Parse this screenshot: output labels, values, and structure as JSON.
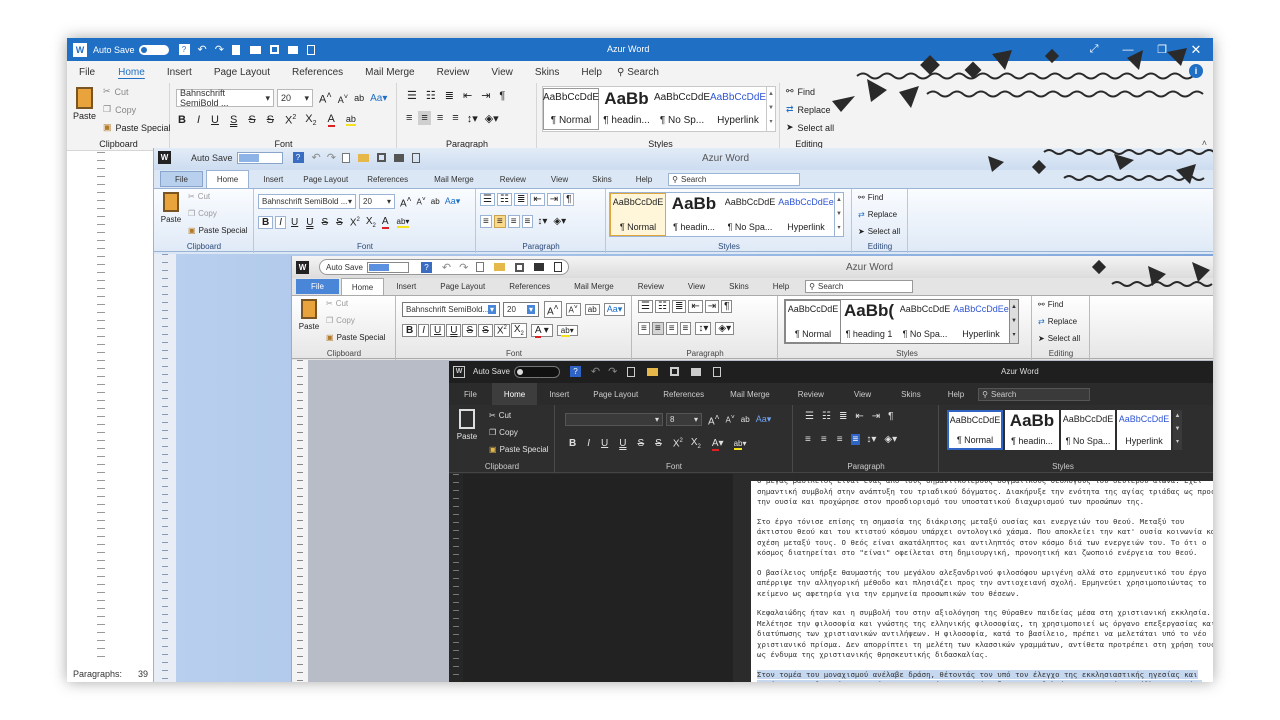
{
  "tabs": [
    "File",
    "Home",
    "Insert",
    "Page Layout",
    "References",
    "Mail Merge",
    "Review",
    "View",
    "Skins",
    "Help"
  ],
  "w1": {
    "autosave": "Auto Save",
    "title": "Azur Word",
    "search": "Search",
    "font_name": "Bahnschrift SemiBold ...",
    "font_size": "20",
    "clip": {
      "paste": "Paste",
      "cut": "Cut",
      "copy": "Copy",
      "paste_special": "Paste Special"
    },
    "groups": {
      "clipboard": "Clipboard",
      "font": "Font",
      "paragraph": "Paragraph",
      "styles": "Styles",
      "editing": "Editing"
    },
    "styles": [
      {
        "sample": "AaBbCcDdE",
        "name": "¶ Normal"
      },
      {
        "sample": "AaBb",
        "name": "¶ headin..."
      },
      {
        "sample": "AaBbCcDdE",
        "name": "¶ No Sp..."
      },
      {
        "sample": "AaBbCcDdE",
        "name": "Hyperlink"
      }
    ],
    "editing": {
      "find": "Find",
      "replace": "Replace",
      "select_all": "Select all"
    },
    "status_label": "Paragraphs:",
    "status_value": "39",
    "status_extra": "W"
  },
  "w2": {
    "autosave": "Auto Save",
    "title": "Azur Word",
    "search": "Search",
    "font_name": "Bahnschrift SemiBold ...",
    "font_size": "20",
    "clip": {
      "paste": "Paste",
      "cut": "Cut",
      "copy": "Copy",
      "paste_special": "Paste Special"
    },
    "groups": {
      "clipboard": "Clipboard",
      "font": "Font",
      "paragraph": "Paragraph",
      "styles": "Styles",
      "editing": "Editing"
    },
    "styles": [
      {
        "sample": "AaBbCcDdE",
        "name": "¶ Normal"
      },
      {
        "sample": "AaBb",
        "name": "¶ headin..."
      },
      {
        "sample": "AaBbCcDdE",
        "name": "¶ No Spa..."
      },
      {
        "sample": "AaBbCcDdEe",
        "name": "Hyperlink"
      }
    ],
    "editing": {
      "find": "Find",
      "replace": "Replace",
      "select_all": "Select all"
    }
  },
  "w3": {
    "autosave": "Auto Save",
    "title": "Azur Word",
    "search": "Search",
    "font_name": "Bahnschrift SemiBold...",
    "font_size": "20",
    "clip": {
      "paste": "Paste",
      "cut": "Cut",
      "copy": "Copy",
      "paste_special": "Paste Special"
    },
    "groups": {
      "clipboard": "Clipboard",
      "font": "Font",
      "paragraph": "Paragraph",
      "styles": "Styles",
      "editing": "Editing"
    },
    "styles": [
      {
        "sample": "AaBbCcDdE",
        "name": "¶ Normal"
      },
      {
        "sample": "AaBb(",
        "name": "¶ heading 1"
      },
      {
        "sample": "AaBbCcDdE",
        "name": "¶ No Spa..."
      },
      {
        "sample": "AaBbCcDdEe",
        "name": "Hyperlink"
      }
    ],
    "editing": {
      "find": "Find",
      "replace": "Replace",
      "select_all": "Select all"
    }
  },
  "w4": {
    "autosave": "Auto Save",
    "title": "Azur Word",
    "search": "Search",
    "font_name": "",
    "font_size": "8",
    "clip": {
      "paste": "Paste",
      "cut": "Cut",
      "copy": "Copy",
      "paste_special": "Paste Special"
    },
    "groups": {
      "clipboard": "Clipboard",
      "font": "Font",
      "paragraph": "Paragraph",
      "styles": "Styles"
    },
    "styles": [
      {
        "sample": "AaBbCcDdE",
        "name": "¶ Normal"
      },
      {
        "sample": "AaBb",
        "name": "¶ headin..."
      },
      {
        "sample": "AaBbCcDdE",
        "name": "¶ No Spa..."
      },
      {
        "sample": "AaBbCcDdE",
        "name": "Hyperlink"
      }
    ]
  },
  "doc": {
    "paragraphs": [
      "Ο μέγας βασίλειος είναι ένας από τους σημαντικότερους δογματικούς θεολόγους του δεύτερου αιώνα. Έχει σημαντική συμβολή στην ανάπτυξη του τριαδικού δόγματος. Διακήρυξε την ενότητα της αγίας τριάδας ως προς την ουσία και προχώρησε στον προσδιορισμό του υποστατικού διαχωρισμού των προσώπων της.",
      "Στο έργο τόνισε επίσης τη σημασία της διάκρισης μεταξύ ουσίας και ενεργειών του θεού. Μεταξύ του άκτιστου θεού και του κτιστού κόσμου υπάρχει οντολογικό χάσμα. Που αποκλείει την κατ' ουσία κοινωνία και σχέση μεταξύ τους. Ο θεός είναι ακατάληπτος και αντιληπτός στον κόσμο διά των ενεργειών του. Το ότι ο κόσμος διατηρείται στο \"είναι\" οφείλεται στη δημιουργική, προνοητική και ζωοποιό ενέργεια του θεού.",
      "Ο βασίλειος υπήρξε θαυμαστής του μεγάλου αλεξανδρινού φιλοσόφου ωριγένη αλλά στο ερμηνευτικό του έργο απέρριψε την αλληγορική μέθοδο και πλησιάζει προς την αντιοχειανή σχολή. Ερμηνεύει χρησιμοποιώντας το κείμενο ως αφετηρία για την ερμηνεία προσωπικών του θέσεων.",
      "Κεφαλαιώδης ήταν και η συμβολή του στην αξιολόγηση της θύραθεν παιδείας μέσα στη χριστιανική εκκλησία. Μελέτησε την φιλοσοφία και γνώστης της ελληνικής φιλοσοφίας, τη χρησιμοποιεί ως όργανο επεξεργασίας και διατύπωσης των χριστιανικών αντιλήψεων. Η φιλοσοφία, κατά το βασίλειο, πρέπει να μελετάται υπό το νέο χριστιανικό πρίσμα. Δεν απορρίπτει τη μελέτη των κλασσικών γραμμάτων, αντίθετα προτρέπει στη χρήση τους ως ένδυμα της χριστιανικής θρησκευτικής διδασκαλίας."
    ],
    "highlighted": "Στον τομέα του μοναχισμού ανέλαβε δράση, θέτοντάς τον υπό τον έλεγχο της εκκλησιαστικής ηγεσίας και εισήγαγε το ιδανικό της αφιέρωσης στο θεό και της ένταξης στην αδελφότητα, η οποία προέβλεπε αγωγία, υπακοή και ακτημοσύνη. Εμπέδωσε την αυθαίρετη πνευματικότητα του μοναχισμού στη σταθερή βάση της αγίας γραφής και τοποθέτησε τους μοναχούς στο πλαίσιο του κοινού βίου και της οργανωμένης δράσης."
  },
  "colors": {
    "titlebar_blue": "#1f6fc5",
    "ribbon_light": "#f3f3f3",
    "ribbon_blue2": "#dbe7f5",
    "ribbon_grey": "#e4e4e4",
    "dark_bg": "#2b2b2b",
    "dark_title": "#1f1f1f"
  }
}
